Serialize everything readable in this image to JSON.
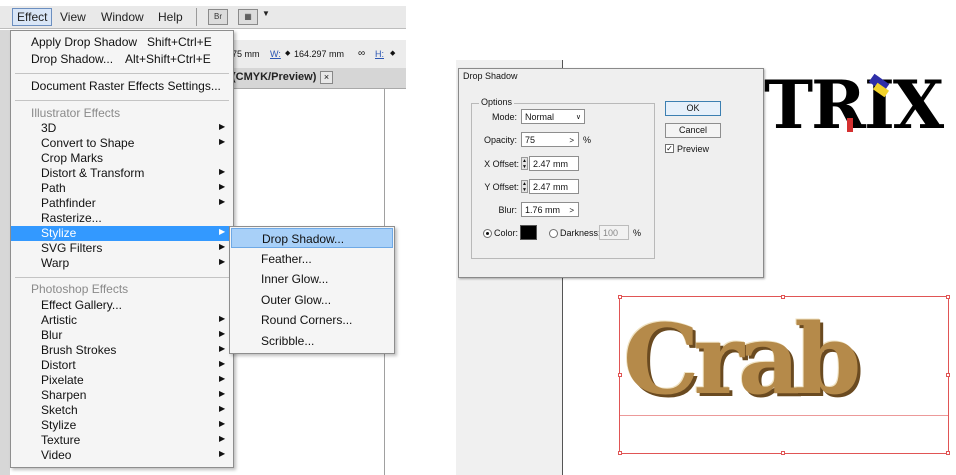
{
  "menubar": {
    "items": [
      "Effect",
      "View",
      "Window",
      "Help"
    ],
    "bridge_icon": "Br"
  },
  "control_bar": {
    "x_value": "75 mm",
    "w_label": "W:",
    "w_value": "164.297 mm",
    "h_label": "H:"
  },
  "document_tab": {
    "title": "(CMYK/Preview)",
    "close": "×"
  },
  "effect_menu": {
    "top_items": [
      {
        "label": "Apply Drop Shadow",
        "shortcut": "Shift+Ctrl+E"
      },
      {
        "label": "Drop Shadow...",
        "shortcut": "Alt+Shift+Ctrl+E"
      }
    ],
    "raster_settings": "Document Raster Effects Settings...",
    "illustrator_header": "Illustrator Effects",
    "illustrator_items": [
      {
        "label": "3D",
        "arrow": true
      },
      {
        "label": "Convert to Shape",
        "arrow": true
      },
      {
        "label": "Crop Marks",
        "arrow": false
      },
      {
        "label": "Distort & Transform",
        "arrow": true
      },
      {
        "label": "Path",
        "arrow": true
      },
      {
        "label": "Pathfinder",
        "arrow": true
      },
      {
        "label": "Rasterize...",
        "arrow": false
      },
      {
        "label": "Stylize",
        "arrow": true,
        "highlighted": true
      },
      {
        "label": "SVG Filters",
        "arrow": true
      },
      {
        "label": "Warp",
        "arrow": true
      }
    ],
    "photoshop_header": "Photoshop Effects",
    "photoshop_items": [
      {
        "label": "Effect Gallery...",
        "arrow": false
      },
      {
        "label": "Artistic",
        "arrow": true
      },
      {
        "label": "Blur",
        "arrow": true
      },
      {
        "label": "Brush Strokes",
        "arrow": true
      },
      {
        "label": "Distort",
        "arrow": true
      },
      {
        "label": "Pixelate",
        "arrow": true
      },
      {
        "label": "Sharpen",
        "arrow": true
      },
      {
        "label": "Sketch",
        "arrow": true
      },
      {
        "label": "Stylize",
        "arrow": true
      },
      {
        "label": "Texture",
        "arrow": true
      },
      {
        "label": "Video",
        "arrow": true
      }
    ]
  },
  "stylize_submenu": {
    "items": [
      "Drop Shadow...",
      "Feather...",
      "Inner Glow...",
      "Outer Glow...",
      "Round Corners...",
      "Scribble..."
    ]
  },
  "dialog": {
    "title": "Drop Shadow",
    "group_label": "Options",
    "mode_label": "Mode:",
    "mode_value": "Normal",
    "opacity_label": "Opacity:",
    "opacity_value": "75",
    "opacity_unit": "%",
    "x_offset_label": "X Offset:",
    "x_offset_value": "2.47 mm",
    "y_offset_label": "Y Offset:",
    "y_offset_value": "2.47 mm",
    "blur_label": "Blur:",
    "blur_value": "1.76 mm",
    "color_label": "Color:",
    "color_value": "#000000",
    "darkness_label": "Darkness:",
    "darkness_value": "100",
    "darkness_unit": "%",
    "ok_label": "OK",
    "cancel_label": "Cancel",
    "preview_label": "Preview",
    "preview_checked": true
  },
  "artwork": {
    "trix_text": "TRIX",
    "crab_text": "Crab"
  },
  "colors": {
    "menu_highlight": "#3399ff",
    "submenu_highlight": "#a8d0f8",
    "selection": "#e05555",
    "shadow_color": "#000000"
  }
}
